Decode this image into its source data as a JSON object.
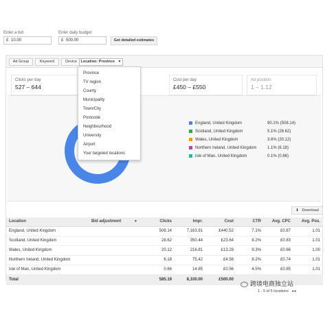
{
  "top": {
    "bid_label": "Enter a bid",
    "bid_currency": "£",
    "bid_value": "10.00",
    "budget_label": "Enter daily budget",
    "budget_currency": "£",
    "budget_value": "500.00",
    "estimate_button": "Get detailed estimates"
  },
  "tabs": [
    {
      "label": "Ad Group"
    },
    {
      "label": "Keyword"
    },
    {
      "label": "Device"
    },
    {
      "label": "Location: Province"
    }
  ],
  "dropdown_arrow": "▼",
  "stats": [
    {
      "title": "Clicks per day",
      "value": "527 – 644"
    },
    {
      "title": "Cost per day",
      "value": "£450 – £550"
    },
    {
      "title": "Ad position",
      "value": "1 – 1.12"
    }
  ],
  "dropdown": [
    "Province",
    "TV region",
    "County",
    "Municipality",
    "Town/City",
    "Postcode",
    "Neighbourhood",
    "University",
    "Airport",
    "Your targeted locations"
  ],
  "chart_data": {
    "type": "pie",
    "categories": [
      "England, United Kingdom",
      "Scotland, United Kingdom",
      "Wales, United Kingdom",
      "Northern Ireland, United Kingdom",
      "Isle of Man, United Kingdom"
    ],
    "values": [
      90.1,
      5.1,
      3.6,
      1.1,
      0.1
    ],
    "value_labels": [
      "90.1% (508.14)",
      "5.1% (28.62)",
      "3.6% (20.12)",
      "1.1% (6.18)",
      "0.1% (0.66)"
    ],
    "colors": [
      "#4a86e8",
      "#34a853",
      "#ff9900",
      "#ab47bc",
      "#1abc9c"
    ],
    "legend_position": "right"
  },
  "download_label": "Download",
  "table": {
    "headers": [
      "Location",
      "Bid adjustment",
      "Clicks",
      "Impr.",
      "Cost",
      "CTR",
      "Avg. CPC",
      "Avg. Pos."
    ],
    "rows": [
      [
        "England, United Kingdom",
        "",
        "508.14",
        "7,163.91",
        "£440.52",
        "7.1%",
        "£0.87",
        "1.01"
      ],
      [
        "Scotland, United Kingdom",
        "",
        "28.62",
        "350.44",
        "£23.64",
        "8.2%",
        "£0.83",
        "1.01"
      ],
      [
        "Wales, United Kingdom",
        "",
        "20.12",
        "216.81",
        "£13.29",
        "9.3%",
        "£0.66",
        "1.00"
      ],
      [
        "Northern Ireland, United Kingdom",
        "",
        "6.18",
        "75.42",
        "£4.58",
        "8.2%",
        "£0.74",
        "1.01"
      ],
      [
        "Isle of Man, United Kingdom",
        "",
        "0.66",
        "14.85",
        "£0.56",
        "4.5%",
        "£0.85",
        "1.01"
      ]
    ],
    "total": [
      "Total",
      "",
      "585.19",
      "8,100.00",
      "£500.00",
      "",
      "",
      ""
    ],
    "sort_arrow": "▼"
  },
  "pager": "1 - 5 of 5 locations",
  "watermark": "跨境电商独立站"
}
